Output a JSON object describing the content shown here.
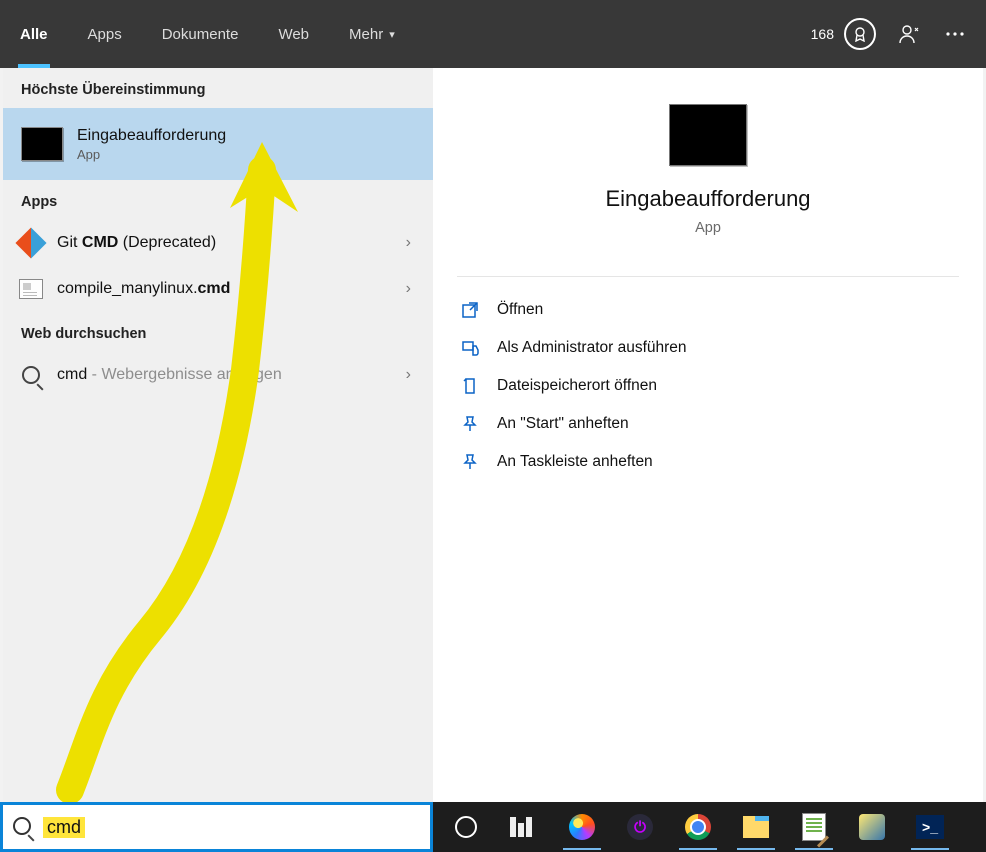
{
  "topbar": {
    "tabs": {
      "all": "Alle",
      "apps": "Apps",
      "documents": "Dokumente",
      "web": "Web",
      "more": "Mehr"
    },
    "points": "168"
  },
  "left": {
    "bestMatchLabel": "Höchste Übereinstimmung",
    "bestResult": {
      "title": "Eingabeaufforderung",
      "subtitle": "App"
    },
    "appsLabel": "Apps",
    "appResults": [
      {
        "titlePrefix": "Git ",
        "titleBold": "CMD",
        "titleSuffix": " (Deprecated)"
      },
      {
        "titlePrefix": "compile_manylinux.",
        "titleBold": "cmd",
        "titleSuffix": ""
      }
    ],
    "webLabel": "Web durchsuchen",
    "webResult": {
      "query": "cmd",
      "hint": " - Webergebnisse anzeigen"
    }
  },
  "detail": {
    "title": "Eingabeaufforderung",
    "subtitle": "App",
    "actions": {
      "open": "Öffnen",
      "admin": "Als Administrator ausführen",
      "location": "Dateispeicherort öffnen",
      "pinStart": "An \"Start\" anheften",
      "pinTaskbar": "An Taskleiste anheften"
    }
  },
  "search": {
    "query": "cmd"
  }
}
